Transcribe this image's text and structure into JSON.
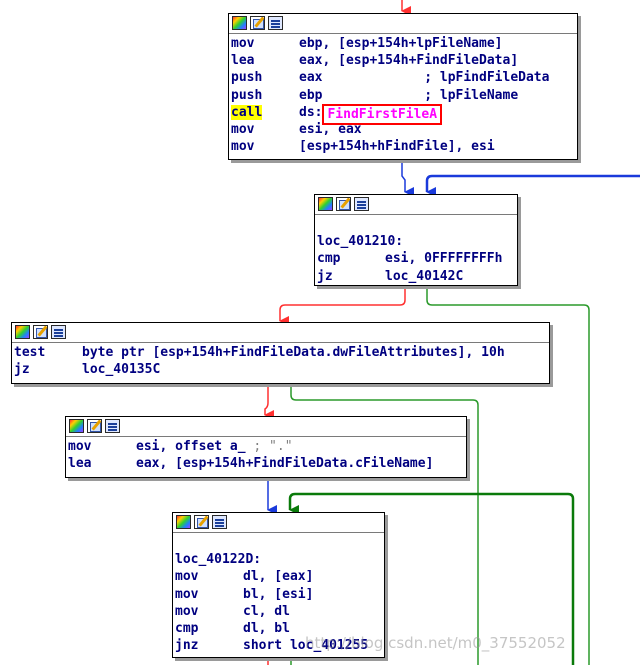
{
  "colors": {
    "true_edge": "#2b9a2b",
    "false_edge": "#ff3030",
    "flow_edge": "#1a3adb",
    "back_edge": "#0a7a0a",
    "entry_edge": "#ff3030",
    "highlight_box": "#ff0000",
    "highlight_call": "#ffff00",
    "api_name": "#ff00ff"
  },
  "node_icons": [
    "color-palette-icon",
    "edit-node-icon",
    "graph-overview-icon"
  ],
  "nodes": [
    {
      "id": "node1",
      "lines": [
        {
          "mnemonic": "mov",
          "operand": "ebp, [esp+154h+lpFileName]"
        },
        {
          "mnemonic": "lea",
          "operand": "eax, [esp+154h+FindFileData]"
        },
        {
          "mnemonic": "push",
          "operand": "eax             ; lpFindFileData"
        },
        {
          "mnemonic": "push",
          "operand": "ebp             ; lpFileName"
        },
        {
          "mnemonic": "call",
          "operand_prefix": "ds:",
          "operand": "FindFirstFileA"
        },
        {
          "mnemonic": "mov",
          "operand": "esi, eax"
        },
        {
          "mnemonic": "mov",
          "operand": "[esp+154h+hFindFile], esi"
        }
      ]
    },
    {
      "id": "node2",
      "label": "loc_401210:",
      "lines": [
        {
          "mnemonic": "cmp",
          "operand": "esi, 0FFFFFFFFh"
        },
        {
          "mnemonic": "jz",
          "operand": "loc_40142C"
        }
      ]
    },
    {
      "id": "node3",
      "lines": [
        {
          "mnemonic": "test",
          "operand": "byte ptr [esp+154h+FindFileData.dwFileAttributes], 10h"
        },
        {
          "mnemonic": "jz",
          "operand": "loc_40135C"
        }
      ]
    },
    {
      "id": "node4",
      "lines": [
        {
          "mnemonic": "mov",
          "operand": "esi, offset a_",
          "comment": " ; \".\""
        },
        {
          "mnemonic": "lea",
          "operand": "eax, [esp+154h+FindFileData.cFileName]"
        }
      ]
    },
    {
      "id": "node5",
      "label": "loc_40122D:",
      "lines": [
        {
          "mnemonic": "mov",
          "operand": "dl, [eax]"
        },
        {
          "mnemonic": "mov",
          "operand": "bl, [esi]"
        },
        {
          "mnemonic": "mov",
          "operand": "cl, dl"
        },
        {
          "mnemonic": "cmp",
          "operand": "dl, bl"
        },
        {
          "mnemonic": "jnz",
          "operand": "short loc_401255"
        }
      ]
    }
  ],
  "watermark": "http://blog.csdn.net/m0_37552052"
}
